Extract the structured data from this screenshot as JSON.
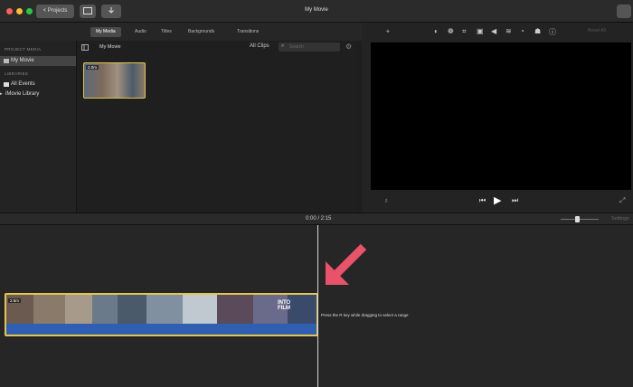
{
  "window": {
    "title": "My Movie",
    "projects_button": "< Projects"
  },
  "colors": {
    "accent": "#e3c64e",
    "audio": "#2f5fb3",
    "arrow": "#e8536a"
  },
  "browser_tabs": [
    {
      "label": "My Media",
      "active": true
    },
    {
      "label": "Audio",
      "active": false
    },
    {
      "label": "Titles",
      "active": false
    },
    {
      "label": "Backgrounds",
      "active": false
    },
    {
      "label": "Transitions",
      "active": false
    }
  ],
  "sidebar": {
    "project_header": "PROJECT MEDIA",
    "project_item": "My Movie",
    "libraries_header": "LIBRARIES",
    "items": [
      "All Events",
      "iMovie Library"
    ]
  },
  "browser": {
    "event_name": "My Movie",
    "filter": "All Clips",
    "search_placeholder": "Search",
    "thumbnail_duration": "2.0m"
  },
  "timeline": {
    "timecode": "0:00 / 2:15",
    "settings": "Settings",
    "clip_duration": "2.5m",
    "hint": "Press the R key while dragging to select a range",
    "title_overlay": "INTO FILM"
  }
}
